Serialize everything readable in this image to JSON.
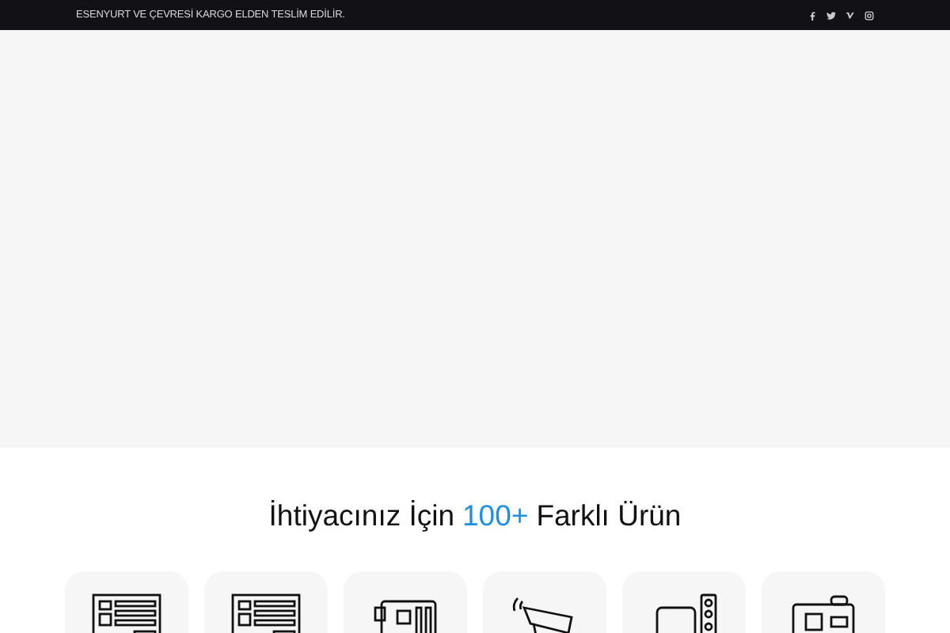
{
  "top_bar": {
    "notice": "ESENYURT VE ÇEVRESİ KARGO ELDEN TESLİM EDİLİR."
  },
  "section": {
    "heading_start": "İhtiyacınız İçin",
    "heading_highlight": "100+",
    "heading_end": "Farklı Ürün"
  }
}
